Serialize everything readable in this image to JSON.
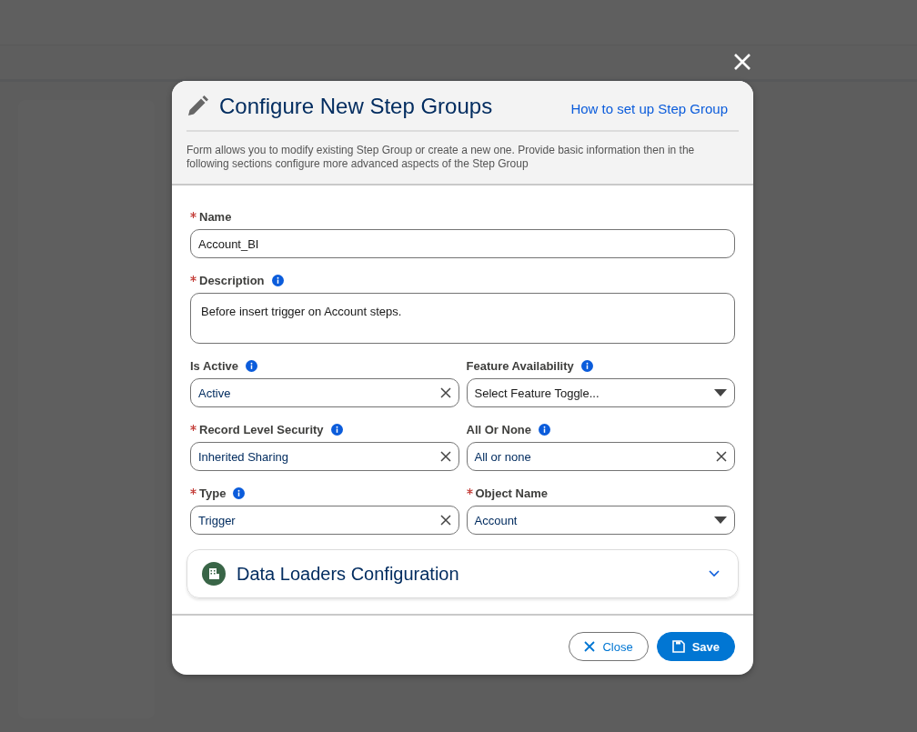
{
  "dialog": {
    "title": "Configure New Step Groups",
    "help_link": "How to set up Step Group",
    "description": "Form allows you to modify existing Step Group or create a new one. Provide basic information then in the following sections configure more advanced aspects of the Step Group"
  },
  "fields": [
    {
      "label": "Name",
      "required": true,
      "info": false,
      "kind": "text",
      "value": "Account_BI"
    },
    {
      "label": "Description",
      "required": true,
      "info": true,
      "kind": "textarea",
      "value": "Before insert trigger on Account steps."
    },
    {
      "label": "Is Active",
      "required": false,
      "info": true,
      "kind": "clearable",
      "value": "Active"
    },
    {
      "label": "Feature Availability",
      "required": false,
      "info": true,
      "kind": "select",
      "placeholder": "Select Feature Toggle..."
    },
    {
      "label": "Record Level Security",
      "required": true,
      "info": true,
      "kind": "clearable",
      "value": "Inherited Sharing"
    },
    {
      "label": "All Or None",
      "required": false,
      "info": true,
      "kind": "clearable",
      "value": "All or none"
    },
    {
      "label": "Type",
      "required": true,
      "info": true,
      "kind": "clearable",
      "value": "Trigger"
    },
    {
      "label": "Object Name",
      "required": true,
      "info": false,
      "kind": "select",
      "value": "Account"
    }
  ],
  "section": {
    "title": "Data Loaders Configuration",
    "expanded": false
  },
  "buttons": [
    {
      "label": "Close",
      "kind": "neutral"
    },
    {
      "label": "Save",
      "kind": "brand"
    }
  ]
}
